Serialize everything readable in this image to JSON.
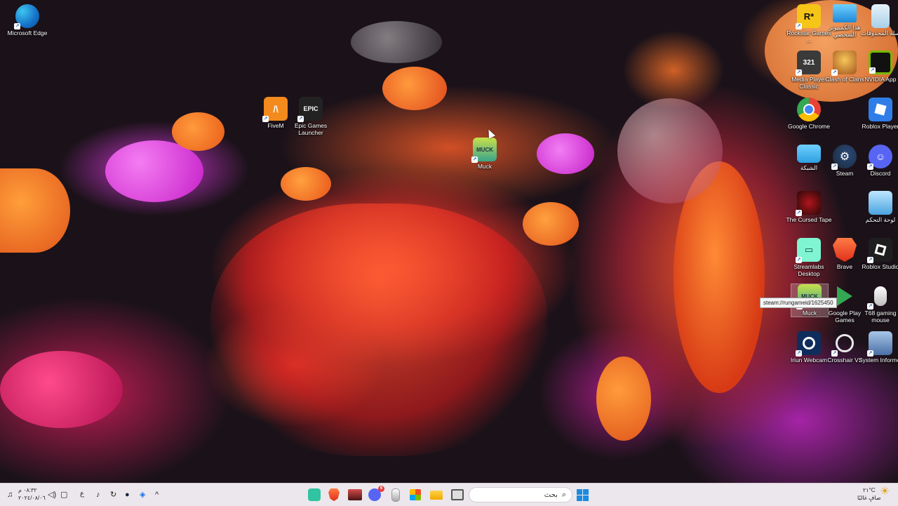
{
  "desktop": {
    "icons": [
      {
        "name": "edge",
        "label": "Microsoft Edge",
        "color": "#1570c6"
      },
      {
        "name": "fivem",
        "label": "FiveM",
        "color": "#f28a1e"
      },
      {
        "name": "epic",
        "label": "Epic Games Launcher",
        "color": "#222222",
        "glyph": "EPIC"
      },
      {
        "name": "muck-center",
        "label": "Muck",
        "color": "#3aa58c",
        "glyph": "MUCK"
      },
      {
        "name": "rockstar",
        "label": "Rockstar Games ...",
        "color": "#f5c518",
        "glyph": "R*"
      },
      {
        "name": "this-pc",
        "label": "هذا الكمبيوتر الشخصي",
        "color": "#37a7e8"
      },
      {
        "name": "recycle-bin",
        "label": "سلة المحذوفات",
        "color": "#a9cfe8"
      },
      {
        "name": "mpc",
        "label": "Media Player Classic",
        "color": "#3a3a3a",
        "glyph": "321"
      },
      {
        "name": "clash",
        "label": "Clash of Clans",
        "color": "#e7a52c"
      },
      {
        "name": "nvidia",
        "label": "NVIDIA App",
        "color": "#76b900"
      },
      {
        "name": "chrome",
        "label": "Google Chrome",
        "color": "#ea4335"
      },
      {
        "name": "roblox-player",
        "label": "Roblox Player",
        "color": "#2f7ee8"
      },
      {
        "name": "network",
        "label": "الشبكة",
        "color": "#2d9fe0"
      },
      {
        "name": "steam",
        "label": "Steam",
        "color": "#1b2838"
      },
      {
        "name": "discord",
        "label": "Discord",
        "color": "#5865f2"
      },
      {
        "name": "cursed-tape",
        "label": "The Cursed Tape",
        "color": "#3a0e10"
      },
      {
        "name": "control-panel",
        "label": "لوحة التحكم",
        "color": "#4aa3df"
      },
      {
        "name": "streamlabs",
        "label": "Streamlabs Desktop",
        "color": "#80f5d2"
      },
      {
        "name": "brave",
        "label": "Brave",
        "color": "#fb542b"
      },
      {
        "name": "roblox-studio",
        "label": "Roblox Studio",
        "color": "#1e1e1e"
      },
      {
        "name": "muck-right",
        "label": "Muck",
        "color": "#3aa58c",
        "glyph": "MUCK"
      },
      {
        "name": "google-play-games",
        "label": "Google Play Games",
        "color": "#1a1a1a"
      },
      {
        "name": "t68-mouse",
        "label": "T68 gaming mouse",
        "color": "#d9d9d9"
      },
      {
        "name": "iriun",
        "label": "Iriun Webcam",
        "color": "#0e2d5c"
      },
      {
        "name": "crosshair",
        "label": "Crosshair V2",
        "color": "#1a1a1a"
      },
      {
        "name": "system-informer",
        "label": "System Informer",
        "color": "#4a6fa5"
      }
    ],
    "tooltip": "steam://rungameid/1625450"
  },
  "taskbar": {
    "search_placeholder": "بحث",
    "weather_temp": "٢١°C",
    "weather_desc": "صافٍ غالبًا",
    "time": "٠٨:٣٢ م",
    "date": "٢٠٢٤/٠٨/٠٦",
    "lang": "ع",
    "apps": [
      "streamlabs",
      "brave",
      "muck-task",
      "discord",
      "mouse-app",
      "store",
      "file-explorer",
      "task-view"
    ],
    "discord_badge": "6"
  }
}
